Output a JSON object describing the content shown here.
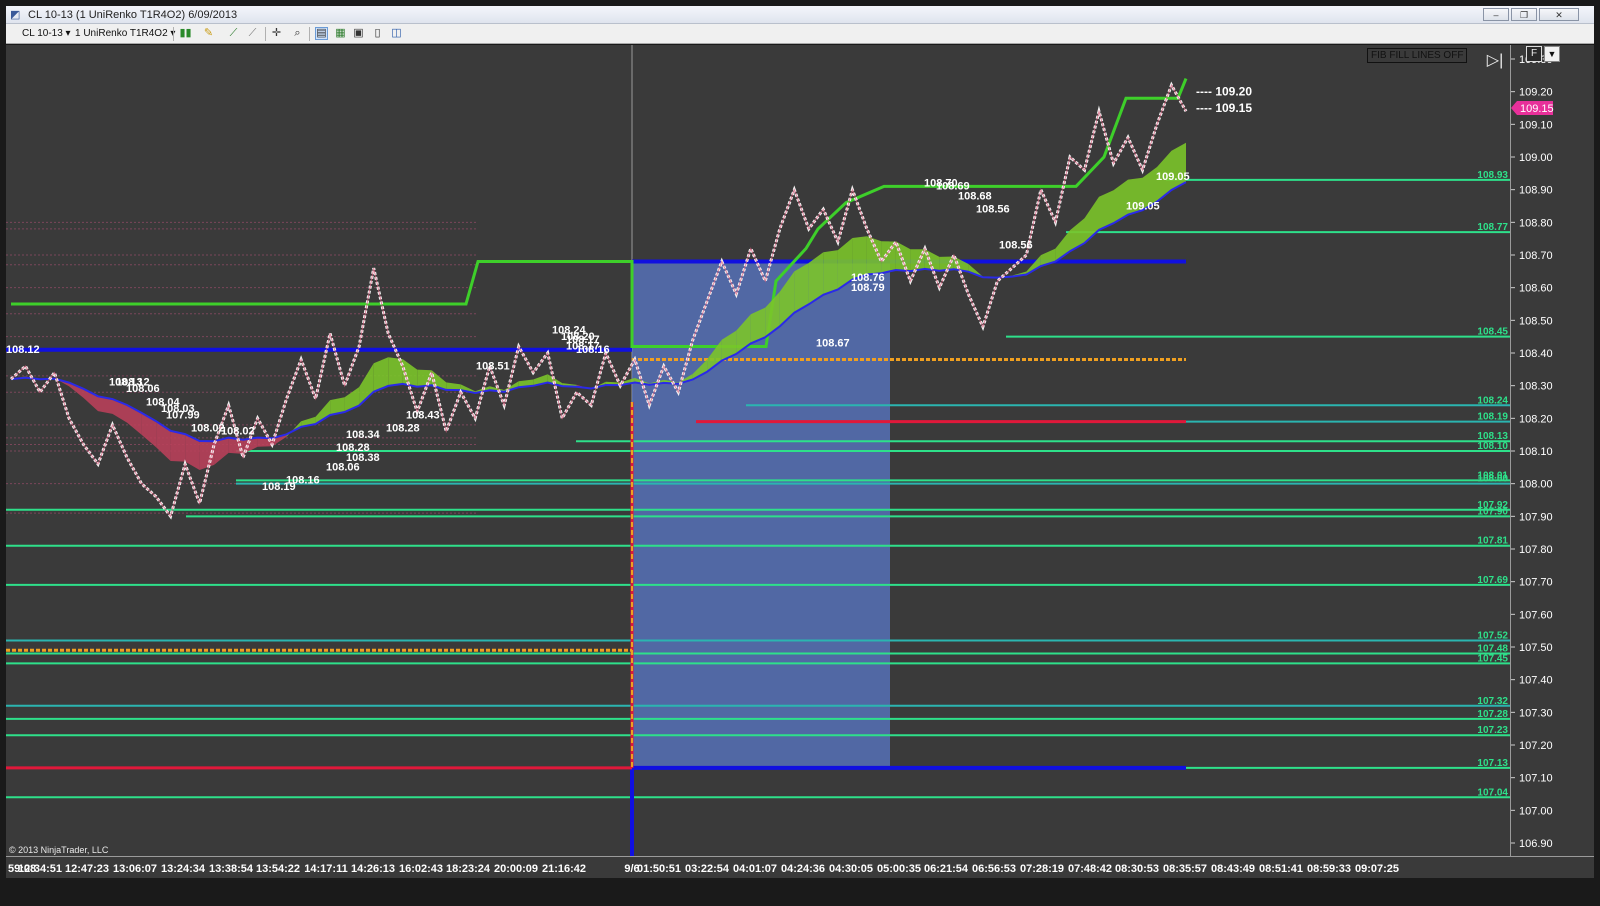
{
  "window": {
    "title": "CL 10-13 (1 UniRenko T1R4O2)  6/09/2013",
    "icon": "chart-window-icon",
    "buttons": {
      "minimize": "–",
      "restore": "❐",
      "close": "✕"
    }
  },
  "toolbar": {
    "instrument": "CL 10-13",
    "period": "1 UniRenko T1R4O2",
    "icons": [
      "bar-style-icon",
      "draw-tool-icon",
      "indicator-icon",
      "strategy-icon",
      "crosshair-icon",
      "zoom-icon",
      "data-box-icon",
      "chart-trader-icon",
      "properties-icon",
      "print-icon",
      "window-link-icon"
    ]
  },
  "overlay": {
    "fib_toggle": "FIB FILL LINES OFF",
    "f_button": "F",
    "dropdown": "▼",
    "scroll_end": "▷|"
  },
  "copyright": "© 2013 NinjaTrader, LLC",
  "colors": {
    "background": "#3a3a3a",
    "support_line": "#2ee08a",
    "teal_line": "#2bb5b0",
    "blue_line": "#1010e0",
    "red_line": "#e0183a",
    "orange_line": "#f0a020",
    "bright_green": "#3ecf2a",
    "current_price_badge": "#e8309a"
  },
  "chart_data": {
    "type": "line",
    "instrument": "CL 10-13",
    "price_axis": {
      "ticks": [
        "109.30",
        "109.20",
        "109.10",
        "109.00",
        "108.90",
        "108.80",
        "108.70",
        "108.60",
        "108.50",
        "108.40",
        "108.30",
        "108.20",
        "108.10",
        "108.00",
        "107.90",
        "107.80",
        "107.70",
        "107.60",
        "107.50",
        "107.40",
        "107.30",
        "107.20",
        "107.10",
        "107.00",
        "106.90"
      ],
      "ylim": [
        106.88,
        109.33
      ],
      "current_price": "109.15"
    },
    "time_axis": {
      "ticks": [
        "59:08",
        "12:34:51",
        "12:47:23",
        "13:06:07",
        "13:24:34",
        "13:38:54",
        "13:54:22",
        "14:17:11",
        "14:26:13",
        "16:02:43",
        "18:23:24",
        "20:00:09",
        "21:16:42",
        "9/6",
        "01:50:51",
        "03:22:54",
        "04:01:07",
        "04:24:36",
        "04:30:05",
        "05:00:35",
        "06:21:54",
        "06:56:53",
        "07:28:19",
        "07:48:42",
        "08:30:53",
        "08:35:57",
        "08:43:49",
        "08:51:41",
        "08:59:33",
        "09:07:25"
      ]
    },
    "right_price_labels": [
      "108.93",
      "108.77",
      "108.45",
      "108.24",
      "108.19",
      "108.13",
      "108.10",
      "108.01",
      "108.00",
      "107.92",
      "107.90",
      "107.81",
      "107.69",
      "107.52",
      "107.48",
      "107.45",
      "107.32",
      "107.28",
      "107.23",
      "107.13",
      "107.04"
    ],
    "projection_labels": [
      "109.20",
      "109.15"
    ],
    "arrow_labels": [
      "108.12",
      "108.13",
      "108.12",
      "108.06",
      "108.04",
      "108.03",
      "107.99",
      "108.02",
      "108.02",
      "108.19",
      "108.16",
      "108.06",
      "108.28",
      "108.38",
      "108.34",
      "108.28",
      "108.43",
      "108.51",
      "108.24",
      "108.20",
      "108.17",
      "108.17",
      "108.16",
      "108.76",
      "108.79",
      "108.67",
      "108.70",
      "108.69",
      "108.68",
      "108.56",
      "108.56",
      "109.05",
      "109.05"
    ],
    "close_path": [
      [
        0,
        108.32
      ],
      [
        1,
        108.36
      ],
      [
        2,
        108.28
      ],
      [
        3,
        108.34
      ],
      [
        4,
        108.2
      ],
      [
        5,
        108.12
      ],
      [
        6,
        108.06
      ],
      [
        7,
        108.18
      ],
      [
        8,
        108.08
      ],
      [
        9,
        108.0
      ],
      [
        10,
        107.96
      ],
      [
        11,
        107.9
      ],
      [
        12,
        108.06
      ],
      [
        13,
        107.94
      ],
      [
        14,
        108.12
      ],
      [
        15,
        108.24
      ],
      [
        16,
        108.08
      ],
      [
        17,
        108.2
      ],
      [
        18,
        108.12
      ],
      [
        19,
        108.26
      ],
      [
        20,
        108.38
      ],
      [
        21,
        108.26
      ],
      [
        22,
        108.46
      ],
      [
        23,
        108.3
      ],
      [
        24,
        108.42
      ],
      [
        25,
        108.66
      ],
      [
        26,
        108.46
      ],
      [
        27,
        108.36
      ],
      [
        28,
        108.22
      ],
      [
        29,
        108.34
      ],
      [
        30,
        108.16
      ],
      [
        31,
        108.28
      ],
      [
        32,
        108.2
      ],
      [
        33,
        108.36
      ],
      [
        34,
        108.24
      ],
      [
        35,
        108.42
      ],
      [
        36,
        108.34
      ],
      [
        37,
        108.4
      ],
      [
        38,
        108.2
      ],
      [
        39,
        108.28
      ],
      [
        40,
        108.24
      ],
      [
        41,
        108.4
      ],
      [
        42,
        108.3
      ],
      [
        43,
        108.38
      ],
      [
        44,
        108.24
      ],
      [
        45,
        108.36
      ],
      [
        46,
        108.28
      ],
      [
        47,
        108.44
      ],
      [
        48,
        108.56
      ],
      [
        49,
        108.68
      ],
      [
        50,
        108.58
      ],
      [
        51,
        108.72
      ],
      [
        52,
        108.62
      ],
      [
        53,
        108.78
      ],
      [
        54,
        108.9
      ],
      [
        55,
        108.78
      ],
      [
        56,
        108.84
      ],
      [
        57,
        108.74
      ],
      [
        58,
        108.9
      ],
      [
        59,
        108.78
      ],
      [
        60,
        108.68
      ],
      [
        61,
        108.74
      ],
      [
        62,
        108.62
      ],
      [
        63,
        108.72
      ],
      [
        64,
        108.6
      ],
      [
        65,
        108.7
      ],
      [
        66,
        108.58
      ],
      [
        67,
        108.48
      ],
      [
        68,
        108.62
      ],
      [
        69,
        108.66
      ],
      [
        70,
        108.7
      ],
      [
        71,
        108.9
      ],
      [
        72,
        108.8
      ],
      [
        73,
        109.0
      ],
      [
        74,
        108.96
      ],
      [
        75,
        109.14
      ],
      [
        76,
        108.98
      ],
      [
        77,
        109.06
      ],
      [
        78,
        108.96
      ],
      [
        79,
        109.1
      ],
      [
        80,
        109.22
      ],
      [
        81,
        109.14
      ]
    ]
  }
}
